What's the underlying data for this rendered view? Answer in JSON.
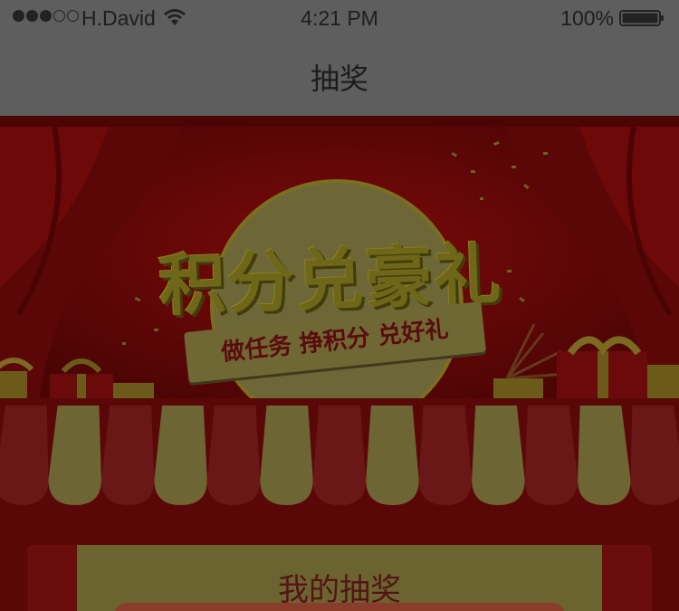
{
  "status_bar": {
    "carrier": "H.David",
    "time": "4:21 PM",
    "battery": "100%",
    "signal_icon": "signal-dots-icon",
    "wifi_icon": "wifi-icon",
    "battery_icon": "battery-icon"
  },
  "nav": {
    "title": "抽奖"
  },
  "banner": {
    "title": "积分兑豪礼",
    "slogan": "做任务  挣积分 兑好礼"
  },
  "panel": {
    "title": "我的抽奖"
  },
  "colors": {
    "overlay_gray": "#5e5e5e",
    "banner_red": "#6a0606",
    "gold": "#6f6734",
    "dark_red": "#5a0707"
  }
}
